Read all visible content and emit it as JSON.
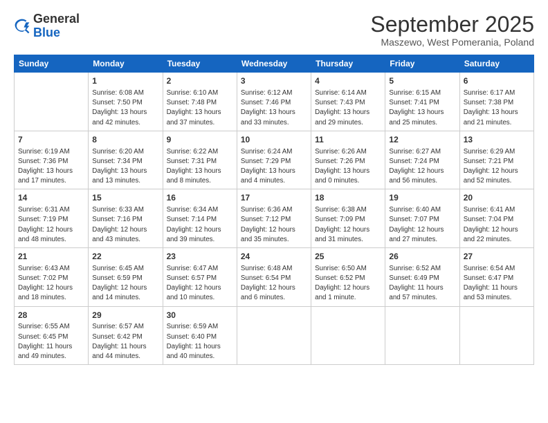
{
  "header": {
    "logo": {
      "general": "General",
      "blue": "Blue"
    },
    "title": "September 2025",
    "location": "Maszewo, West Pomerania, Poland"
  },
  "calendar": {
    "days_of_week": [
      "Sunday",
      "Monday",
      "Tuesday",
      "Wednesday",
      "Thursday",
      "Friday",
      "Saturday"
    ],
    "weeks": [
      [
        {
          "day": "",
          "info": ""
        },
        {
          "day": "1",
          "info": "Sunrise: 6:08 AM\nSunset: 7:50 PM\nDaylight: 13 hours\nand 42 minutes."
        },
        {
          "day": "2",
          "info": "Sunrise: 6:10 AM\nSunset: 7:48 PM\nDaylight: 13 hours\nand 37 minutes."
        },
        {
          "day": "3",
          "info": "Sunrise: 6:12 AM\nSunset: 7:46 PM\nDaylight: 13 hours\nand 33 minutes."
        },
        {
          "day": "4",
          "info": "Sunrise: 6:14 AM\nSunset: 7:43 PM\nDaylight: 13 hours\nand 29 minutes."
        },
        {
          "day": "5",
          "info": "Sunrise: 6:15 AM\nSunset: 7:41 PM\nDaylight: 13 hours\nand 25 minutes."
        },
        {
          "day": "6",
          "info": "Sunrise: 6:17 AM\nSunset: 7:38 PM\nDaylight: 13 hours\nand 21 minutes."
        }
      ],
      [
        {
          "day": "7",
          "info": "Sunrise: 6:19 AM\nSunset: 7:36 PM\nDaylight: 13 hours\nand 17 minutes."
        },
        {
          "day": "8",
          "info": "Sunrise: 6:20 AM\nSunset: 7:34 PM\nDaylight: 13 hours\nand 13 minutes."
        },
        {
          "day": "9",
          "info": "Sunrise: 6:22 AM\nSunset: 7:31 PM\nDaylight: 13 hours\nand 8 minutes."
        },
        {
          "day": "10",
          "info": "Sunrise: 6:24 AM\nSunset: 7:29 PM\nDaylight: 13 hours\nand 4 minutes."
        },
        {
          "day": "11",
          "info": "Sunrise: 6:26 AM\nSunset: 7:26 PM\nDaylight: 13 hours\nand 0 minutes."
        },
        {
          "day": "12",
          "info": "Sunrise: 6:27 AM\nSunset: 7:24 PM\nDaylight: 12 hours\nand 56 minutes."
        },
        {
          "day": "13",
          "info": "Sunrise: 6:29 AM\nSunset: 7:21 PM\nDaylight: 12 hours\nand 52 minutes."
        }
      ],
      [
        {
          "day": "14",
          "info": "Sunrise: 6:31 AM\nSunset: 7:19 PM\nDaylight: 12 hours\nand 48 minutes."
        },
        {
          "day": "15",
          "info": "Sunrise: 6:33 AM\nSunset: 7:16 PM\nDaylight: 12 hours\nand 43 minutes."
        },
        {
          "day": "16",
          "info": "Sunrise: 6:34 AM\nSunset: 7:14 PM\nDaylight: 12 hours\nand 39 minutes."
        },
        {
          "day": "17",
          "info": "Sunrise: 6:36 AM\nSunset: 7:12 PM\nDaylight: 12 hours\nand 35 minutes."
        },
        {
          "day": "18",
          "info": "Sunrise: 6:38 AM\nSunset: 7:09 PM\nDaylight: 12 hours\nand 31 minutes."
        },
        {
          "day": "19",
          "info": "Sunrise: 6:40 AM\nSunset: 7:07 PM\nDaylight: 12 hours\nand 27 minutes."
        },
        {
          "day": "20",
          "info": "Sunrise: 6:41 AM\nSunset: 7:04 PM\nDaylight: 12 hours\nand 22 minutes."
        }
      ],
      [
        {
          "day": "21",
          "info": "Sunrise: 6:43 AM\nSunset: 7:02 PM\nDaylight: 12 hours\nand 18 minutes."
        },
        {
          "day": "22",
          "info": "Sunrise: 6:45 AM\nSunset: 6:59 PM\nDaylight: 12 hours\nand 14 minutes."
        },
        {
          "day": "23",
          "info": "Sunrise: 6:47 AM\nSunset: 6:57 PM\nDaylight: 12 hours\nand 10 minutes."
        },
        {
          "day": "24",
          "info": "Sunrise: 6:48 AM\nSunset: 6:54 PM\nDaylight: 12 hours\nand 6 minutes."
        },
        {
          "day": "25",
          "info": "Sunrise: 6:50 AM\nSunset: 6:52 PM\nDaylight: 12 hours\nand 1 minute."
        },
        {
          "day": "26",
          "info": "Sunrise: 6:52 AM\nSunset: 6:49 PM\nDaylight: 11 hours\nand 57 minutes."
        },
        {
          "day": "27",
          "info": "Sunrise: 6:54 AM\nSunset: 6:47 PM\nDaylight: 11 hours\nand 53 minutes."
        }
      ],
      [
        {
          "day": "28",
          "info": "Sunrise: 6:55 AM\nSunset: 6:45 PM\nDaylight: 11 hours\nand 49 minutes."
        },
        {
          "day": "29",
          "info": "Sunrise: 6:57 AM\nSunset: 6:42 PM\nDaylight: 11 hours\nand 44 minutes."
        },
        {
          "day": "30",
          "info": "Sunrise: 6:59 AM\nSunset: 6:40 PM\nDaylight: 11 hours\nand 40 minutes."
        },
        {
          "day": "",
          "info": ""
        },
        {
          "day": "",
          "info": ""
        },
        {
          "day": "",
          "info": ""
        },
        {
          "day": "",
          "info": ""
        }
      ]
    ]
  }
}
